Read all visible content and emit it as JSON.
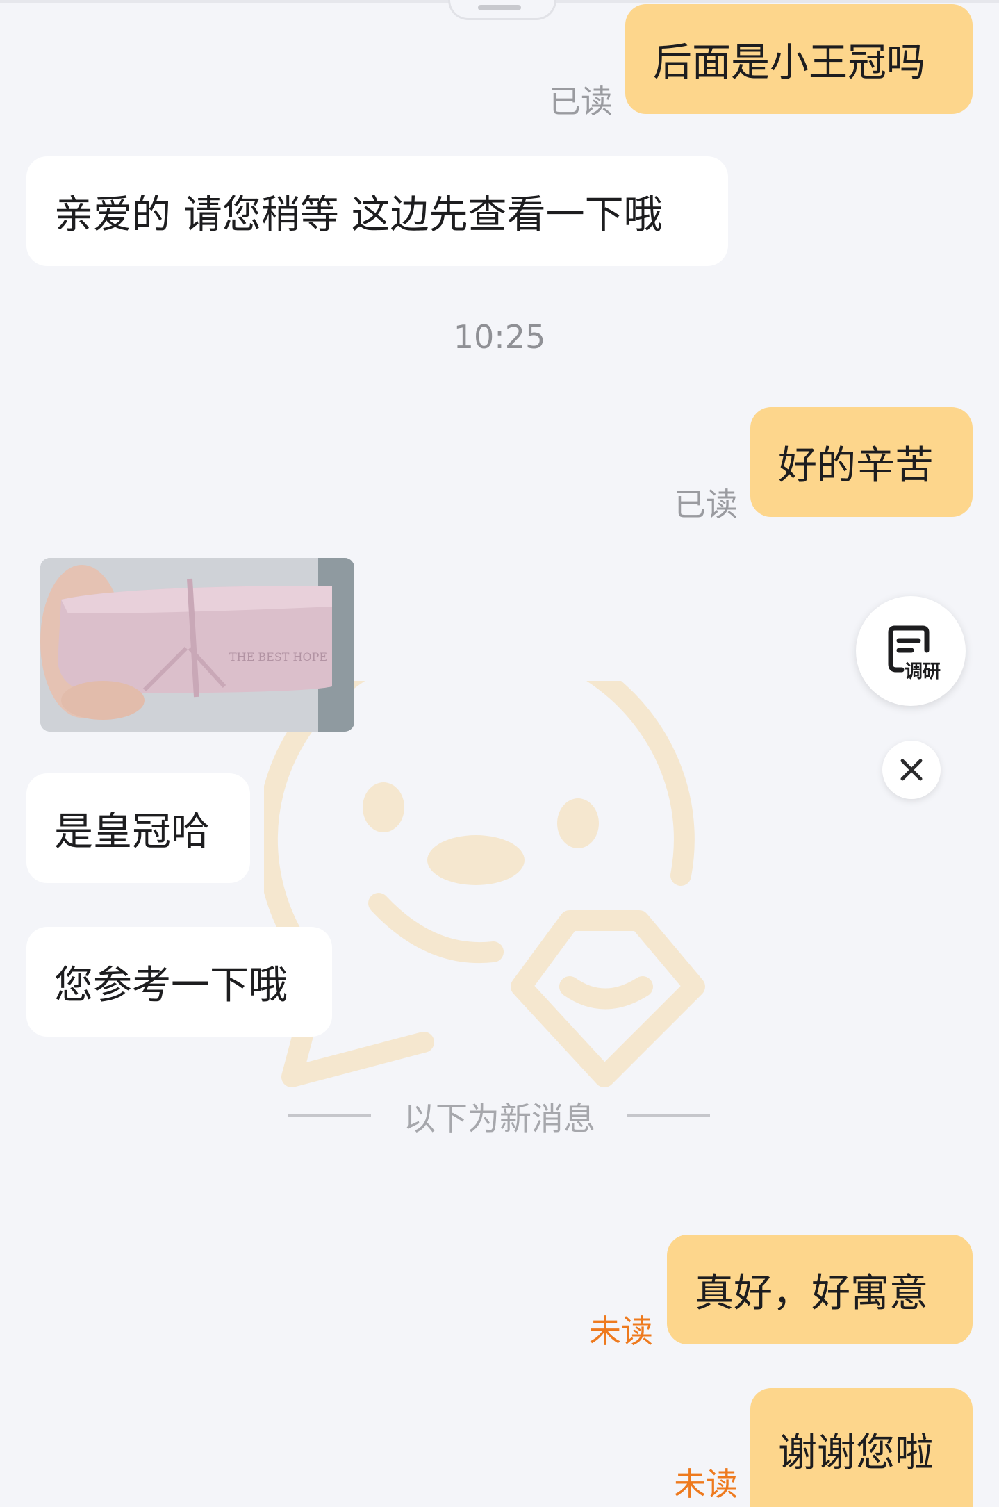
{
  "conversation": {
    "messages": [
      {
        "id": "m1",
        "direction": "outgoing",
        "text": "后面是小王冠吗",
        "status": "已读"
      },
      {
        "id": "m2",
        "direction": "incoming",
        "text": "亲爱的 请您稍等 这边先查看一下哦"
      },
      {
        "id": "m3",
        "direction": "outgoing",
        "text": "好的辛苦",
        "status": "已读"
      },
      {
        "id": "m4",
        "direction": "incoming",
        "type": "image",
        "image": {
          "embossed_text": "THE BEST HOPE"
        }
      },
      {
        "id": "m5",
        "direction": "incoming",
        "text": "是皇冠哈"
      },
      {
        "id": "m6",
        "direction": "incoming",
        "text": "您参考一下哦"
      },
      {
        "id": "m7",
        "direction": "outgoing",
        "text": "真好，好寓意",
        "status": "未读"
      },
      {
        "id": "m8",
        "direction": "outgoing",
        "text": "谢谢您啦",
        "status": "未读"
      }
    ],
    "timestamp": "10:25",
    "new_messages_divider": "以下为新消息"
  },
  "floating": {
    "survey_label": "调研",
    "survey_icon": "survey-doc-icon",
    "close_icon": "close-icon"
  },
  "colors": {
    "background": "#f4f5f9",
    "outgoing_bubble": "#fdd68c",
    "incoming_bubble": "#ffffff",
    "read_status": "#9a9ba0",
    "unread_status": "#ee7a1e"
  }
}
